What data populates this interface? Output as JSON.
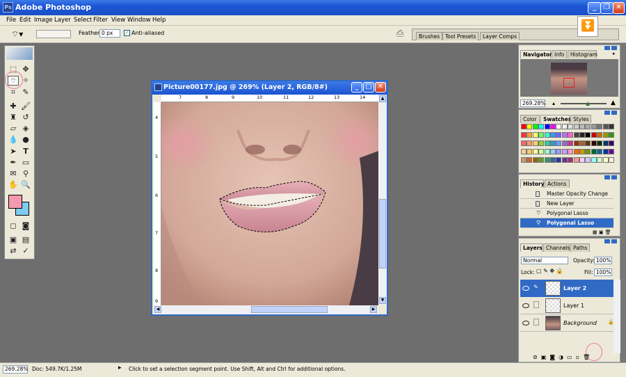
{
  "app": {
    "title": "Adobe Photoshop",
    "logo_text": "Ps"
  },
  "menu": [
    "File",
    "Edit",
    "Image",
    "Layer",
    "Select",
    "Filter",
    "View",
    "Window",
    "Help"
  ],
  "options_bar": {
    "feather_label": "Feather:",
    "feather_value": "0 px",
    "anti_aliased_label": "Anti-aliased",
    "anti_aliased_checked": true,
    "palette_well_tabs": [
      "Brushes",
      "Tool Presets",
      "Layer Comps"
    ]
  },
  "document": {
    "title": "Picture00177.jpg @ 269% (Layer 2, RGB/8#)",
    "ruler_h_ticks": [
      "7",
      "8",
      "9",
      "10",
      "11",
      "12",
      "13",
      "14"
    ],
    "ruler_v_ticks": [
      "4",
      "5",
      "6",
      "7",
      "8",
      "9"
    ]
  },
  "navigator": {
    "tabs": [
      "Navigator",
      "Info",
      "Histogram"
    ],
    "active_tab": "Navigator",
    "zoom": "269.28%"
  },
  "swatches": {
    "tabs": [
      "Color",
      "Swatches",
      "Styles"
    ],
    "active_tab": "Swatches",
    "colors": [
      "#ff0000",
      "#ffff00",
      "#00ff00",
      "#00ffff",
      "#0000ff",
      "#ff00ff",
      "#ffffff",
      "#eeeeee",
      "#dddddd",
      "#cccccc",
      "#bbbbbb",
      "#aaaaaa",
      "#999999",
      "#777777",
      "#555555",
      "#333333",
      "#ff3333",
      "#ff9933",
      "#ffff66",
      "#66ff66",
      "#33ffcc",
      "#3399ff",
      "#6666ff",
      "#cc66ff",
      "#ff66cc",
      "#444444",
      "#222222",
      "#000000",
      "#cc0000",
      "#cc6600",
      "#999900",
      "#339900",
      "#ff6666",
      "#ff9966",
      "#ffcc66",
      "#99cc33",
      "#33cc99",
      "#3399cc",
      "#6699ff",
      "#9966cc",
      "#cc3399",
      "#993300",
      "#996633",
      "#663300",
      "#330000",
      "#003300",
      "#003366",
      "#330066",
      "#ffcc99",
      "#ffcc66",
      "#ffff99",
      "#ccff99",
      "#99ffcc",
      "#99ccff",
      "#9999ff",
      "#cc99ff",
      "#ff99cc",
      "#ff6600",
      "#cc9900",
      "#669900",
      "#006633",
      "#006699",
      "#003399",
      "#660099",
      "#cc9966",
      "#cc6633",
      "#996600",
      "#669933",
      "#339966",
      "#336699",
      "#333399",
      "#663399",
      "#993366",
      "#ff9999",
      "#ffccff",
      "#ccccff",
      "#99ffff",
      "#ccffcc",
      "#ffffcc",
      "#ffeedd"
    ]
  },
  "history": {
    "tabs": [
      "History",
      "Actions"
    ],
    "active_tab": "History",
    "items": [
      {
        "label": "Master Opacity Change",
        "selected": false
      },
      {
        "label": "New Layer",
        "selected": false
      },
      {
        "label": "Polygonal Lasso",
        "selected": false
      },
      {
        "label": "Polygonal Lasso",
        "selected": true
      }
    ]
  },
  "layers": {
    "tabs": [
      "Layers",
      "Channels",
      "Paths"
    ],
    "active_tab": "Layers",
    "blend_mode": "Normal",
    "opacity_label": "Opacity:",
    "opacity_value": "100%",
    "lock_label": "Lock:",
    "fill_label": "Fill:",
    "fill_value": "100%",
    "items": [
      {
        "name": "Layer 2",
        "selected": true,
        "visible": true
      },
      {
        "name": "Layer 1",
        "selected": false,
        "visible": true
      },
      {
        "name": "Background",
        "selected": false,
        "visible": true,
        "locked": true
      }
    ]
  },
  "status": {
    "zoom": "269.28%",
    "doc": "Doc: 549.7K/1.25M",
    "hint": "Click to set a selection segment point.  Use Shift, Alt and Ctrl for additional options."
  },
  "colors": {
    "foreground": "#f49ab0",
    "background": "#7ecbf0",
    "accent": "#316ac5"
  }
}
